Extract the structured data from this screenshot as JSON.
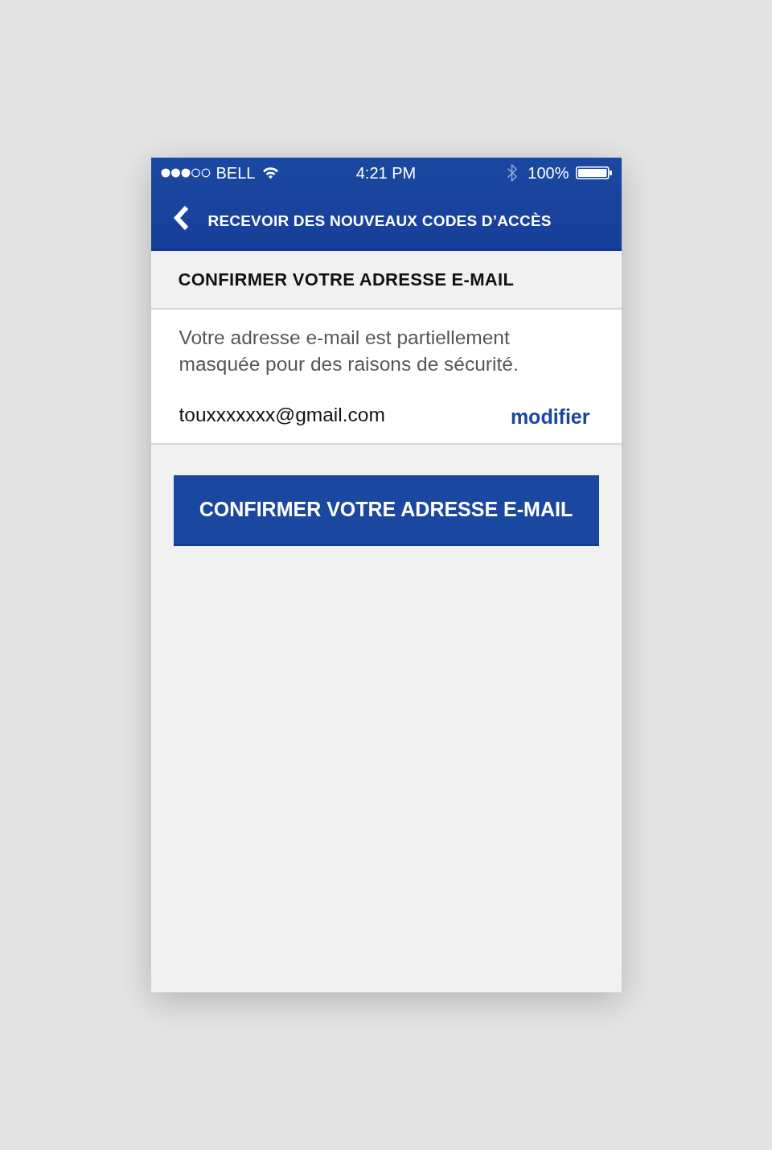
{
  "status_bar": {
    "carrier": "BELL",
    "time": "4:21 PM",
    "battery": "100%"
  },
  "nav_bar": {
    "title": "RECEVOIR DES NOUVEAUX CODES D’ACCÈS"
  },
  "section": {
    "heading": "CONFIRMER VOTRE ADRESSE E-MAIL",
    "description": "Votre adresse e-mail est partiellement masquée pour des raisons de sécurité.",
    "email": "touxxxxxxx@gmail.com",
    "edit_link": "modifier"
  },
  "primary_button": {
    "label": "CONFIRMER VOTRE ADRESSE E-MAIL"
  }
}
